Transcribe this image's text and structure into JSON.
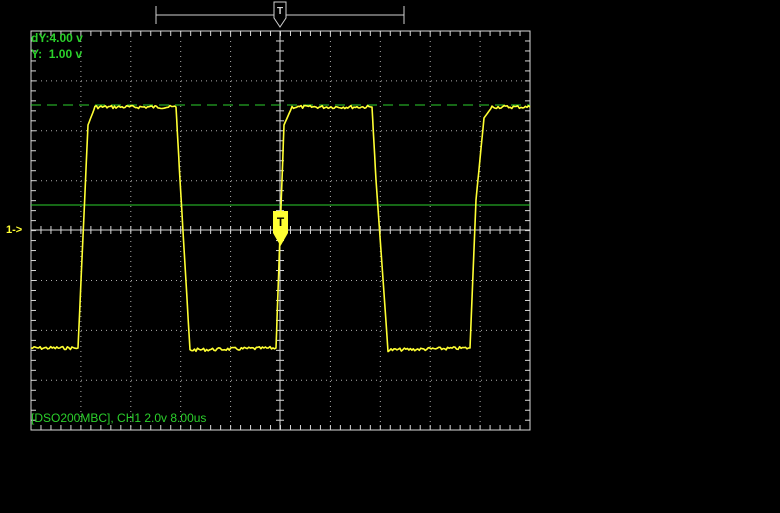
{
  "window": {
    "title": "DSO200MBC"
  },
  "readouts": {
    "dY": "dY:4.00 v",
    "Y": "Y:  1.00 v",
    "status": "[DSO200MBC], CH1 2.0v 8.00us"
  },
  "channel": {
    "marker": "1->",
    "name": "CH1",
    "volts_per_div": "2.0v",
    "time_per_div": "8.00us"
  },
  "trigger": {
    "label": "T"
  },
  "colors": {
    "background": "#000000",
    "grid": "#d8d8d8",
    "trace": "#ffff33",
    "cursor": "#2bd12b",
    "text": "#2bd12b"
  },
  "icons": {
    "trigger_top": "trigger-flag-icon",
    "trigger_level": "trigger-level-icon"
  }
}
